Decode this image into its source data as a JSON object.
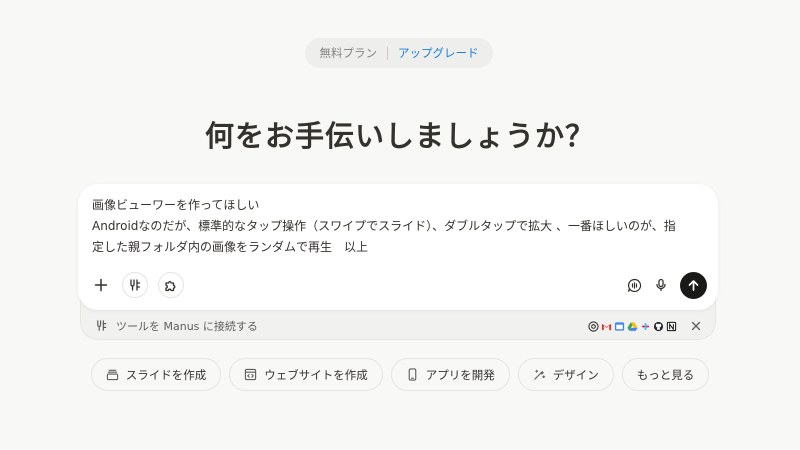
{
  "plan": {
    "free": "無料プラン",
    "upgrade": "アップグレード"
  },
  "headline": "何をお手伝いしましょうか？",
  "composer": {
    "lines": [
      "画像ビューワーを作ってほしい",
      "Androidなのだが、標準的なタップ操作（スワイプでスライド）、ダブルタップで拡大 、一番ほしいのが、指",
      "定した親フォルダ内の画像をランダムで再生　以上"
    ],
    "tools": [
      "plus-icon",
      "tools-icon",
      "puzzle-icon"
    ],
    "right_tools": [
      "voice-chat-icon",
      "microphone-icon"
    ],
    "send_icon": "arrow-up-icon"
  },
  "connect": {
    "label": "ツールを Manus に接続する",
    "apps": [
      "chrome",
      "gmail",
      "calendar",
      "drive",
      "slack",
      "github",
      "notion"
    ]
  },
  "suggestions": [
    {
      "label": "スライドを作成",
      "icon": "slides-icon"
    },
    {
      "label": "ウェブサイトを作成",
      "icon": "code-window-icon"
    },
    {
      "label": "アプリを開発",
      "icon": "phone-icon"
    },
    {
      "label": "デザイン",
      "icon": "design-icon"
    },
    {
      "label": "もっと見る",
      "icon": ""
    }
  ],
  "colors": {
    "accent": "#1a7fd9",
    "send_button": "#1a1a19",
    "background": "#f8f8f7"
  }
}
